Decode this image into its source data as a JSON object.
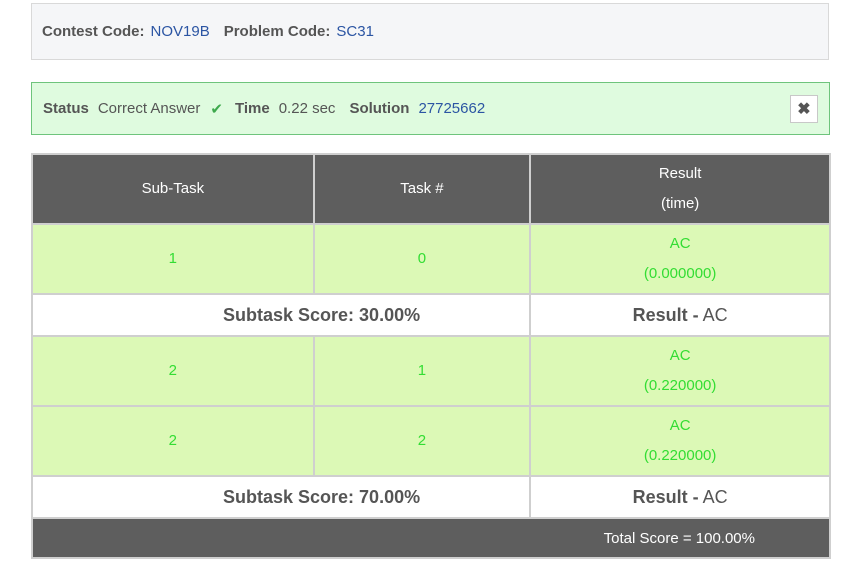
{
  "codes": {
    "contest_label": "Contest Code:",
    "contest_value": "NOV19B",
    "problem_label": "Problem Code:",
    "problem_value": "SC31"
  },
  "status": {
    "status_label": "Status",
    "status_value": "Correct Answer",
    "time_label": "Time",
    "time_value": "0.22 sec",
    "solution_label": "Solution",
    "solution_value": "27725662",
    "close_symbol": "✖",
    "check_symbol": "✔"
  },
  "table": {
    "headers": {
      "subtask": "Sub-Task",
      "task": "Task #",
      "result_line1": "Result",
      "result_line2": "(time)"
    },
    "rows": [
      {
        "subtask": "1",
        "task": "0",
        "result": "AC",
        "time": "(0.000000)"
      },
      {
        "score_label": "Subtask Score: 30.00%",
        "result_label": "Result -",
        "result_value": "AC"
      },
      {
        "subtask": "2",
        "task": "1",
        "result": "AC",
        "time": "(0.220000)"
      },
      {
        "subtask": "2",
        "task": "2",
        "result": "AC",
        "time": "(0.220000)"
      },
      {
        "score_label": "Subtask Score: 70.00%",
        "result_label": "Result -",
        "result_value": "AC"
      }
    ],
    "total": "Total Score = 100.00%"
  }
}
